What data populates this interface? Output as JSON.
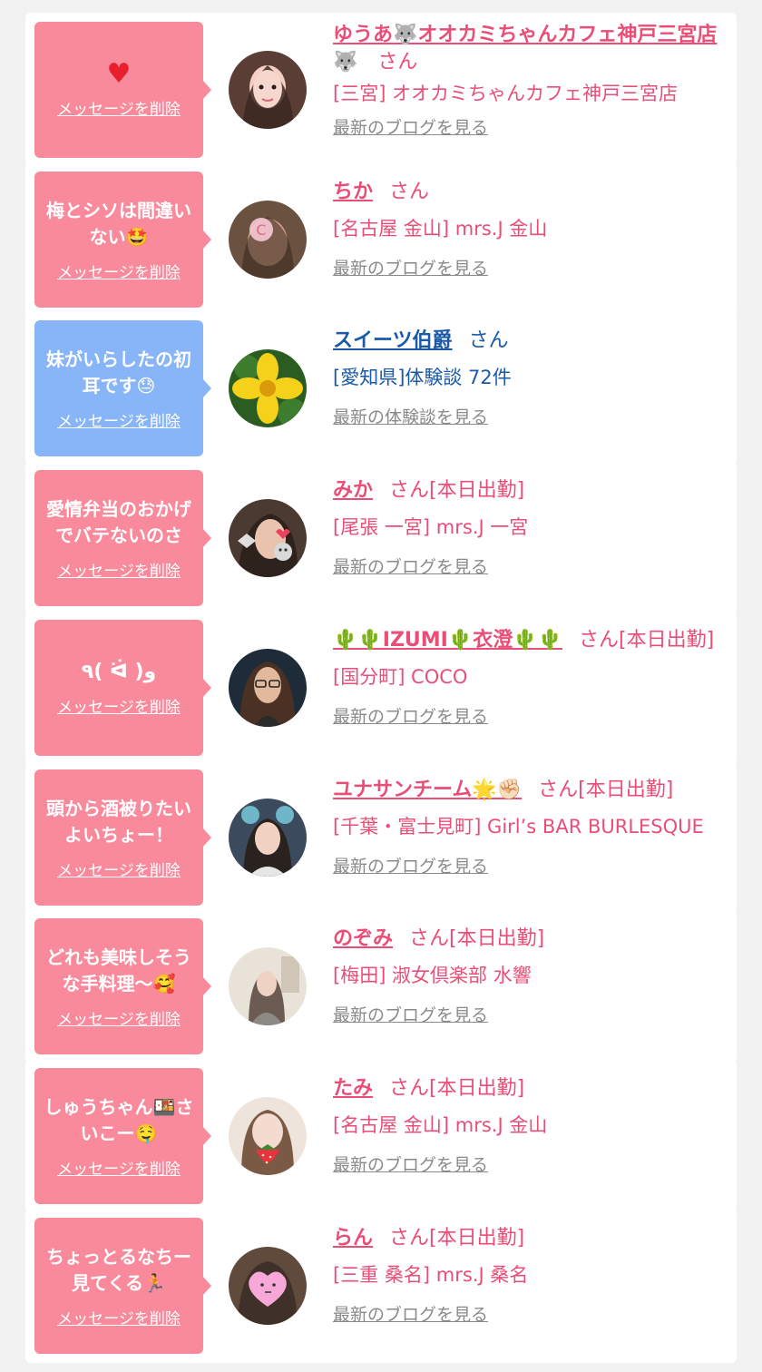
{
  "colors": {
    "pink_bubble": "#f98a9c",
    "blue_bubble": "#88b5f7",
    "pink_text": "#e94e77",
    "blue_text": "#1a5aa8",
    "link_gray": "#8a8a8a"
  },
  "items": [
    {
      "message": "♥",
      "bubble": "pink",
      "delete_label": "メッセージを削除",
      "name": "ゆうあ🐺オオカミちゃんカフェ神戸三宮店",
      "name_line2": "🐺　さん",
      "honorific": "",
      "shop": "[三宮] オオカミちゃんカフェ神戸三宮店",
      "link": "最新のブログを見る",
      "avatar": "woman-portrait"
    },
    {
      "message": "梅とシソは間違い\nない🤩",
      "bubble": "pink",
      "delete_label": "メッセージを削除",
      "name": "ちか",
      "honorific": "さん",
      "shop": "[名古屋 金山] mrs.J 金山",
      "link": "最新のブログを見る",
      "avatar": "blurred-face-with-heart"
    },
    {
      "message": "妹がいらしたの初\n耳です😓",
      "bubble": "blue",
      "delete_label": "メッセージを削除",
      "name": "スイーツ伯爵",
      "honorific": "さん",
      "shop": "[愛知県]体験談 72件",
      "link": "最新の体験談を見る",
      "avatar": "yellow-flower"
    },
    {
      "message": "愛情弁当のおかげ\nでバテないのさ",
      "bubble": "pink",
      "delete_label": "メッセージを削除",
      "name": "みか",
      "honorific": "さん[本日出勤]",
      "shop": "[尾張 一宮] mrs.J 一宮",
      "link": "最新のブログを見る",
      "avatar": "woman-with-cat-sticker"
    },
    {
      "message": "٩( ᐛ )و",
      "bubble": "pink",
      "delete_label": "メッセージを削除",
      "name": "🌵🌵IZUMI🌵衣澄🌵🌵",
      "honorific": "さん[本日出勤]",
      "shop": "[国分町] COCO",
      "link": "最新のブログを見る",
      "avatar": "woman-glasses-long-hair"
    },
    {
      "message": "頭から酒被りたい\nよいちょー！",
      "bubble": "pink",
      "delete_label": "メッセージを削除",
      "name": "ユナサンチーム🌟✊🏻",
      "honorific": "さん[本日出勤]",
      "shop": "[千葉・富士見町] Girl’s BAR BURLESQUE",
      "link": "最新のブログを見る",
      "avatar": "woman-with-balloon-ears"
    },
    {
      "message": "どれも美味しそう\nな手料理～🥰",
      "bubble": "pink",
      "delete_label": "メッセージを削除",
      "name": "のぞみ",
      "honorific": "さん[本日出勤]",
      "shop": "[梅田] 淑女倶楽部 水響",
      "link": "最新のブログを見る",
      "avatar": "woman-light-room"
    },
    {
      "message": "しゅうちゃん🍱さ\nいこー🤤",
      "bubble": "pink",
      "delete_label": "メッセージを削除",
      "name": "たみ",
      "honorific": "さん[本日出勤]",
      "shop": "[名古屋 金山] mrs.J 金山",
      "link": "最新のブログを見る",
      "avatar": "woman-with-strawberry"
    },
    {
      "message": "ちょっとるなちー\n見てくる🏃",
      "bubble": "pink",
      "delete_label": "メッセージを削除",
      "name": "らん",
      "honorific": "さん[本日出勤]",
      "shop": "[三重 桑名] mrs.J 桑名",
      "link": "最新のブログを見る",
      "avatar": "face-hidden-by-pink-heart"
    }
  ]
}
